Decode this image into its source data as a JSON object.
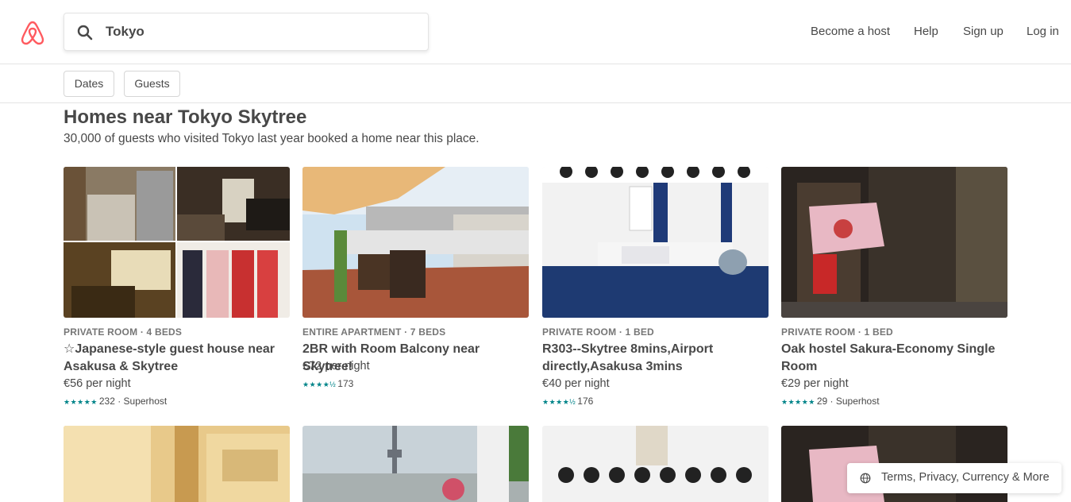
{
  "search": {
    "value": "Tokyo"
  },
  "nav": {
    "host": "Become a host",
    "help": "Help",
    "signup": "Sign up",
    "login": "Log in"
  },
  "filters": {
    "dates": "Dates",
    "guests": "Guests"
  },
  "section": {
    "title": "Homes near Tokyo Skytree",
    "subtitle": "30,000 of guests who visited Tokyo last year booked a home near this place."
  },
  "listings": [
    {
      "kicker": "PRIVATE ROOM · 4 BEDS",
      "title": "☆Japanese-style guest house near Asakusa & Skytree",
      "price": "€56 per night",
      "stars": "★★★★★",
      "rating_text": "232 · Superhost"
    },
    {
      "kicker": "ENTIRE APARTMENT · 7 BEDS",
      "title": "2BR with Room Balcony near Skytree!",
      "price": "€72 per night",
      "stars": "★★★★½",
      "rating_text": "173"
    },
    {
      "kicker": "PRIVATE ROOM · 1 BED",
      "title": "R303--Skytree 8mins,Airport directly,Asakusa 3mins",
      "price": "€40 per night",
      "stars": "★★★★½",
      "rating_text": "176"
    },
    {
      "kicker": "PRIVATE ROOM · 1 BED",
      "title": "Oak hostel Sakura-Economy Single Room",
      "price": "€29 per night",
      "stars": "★★★★★",
      "rating_text": "29 · Superhost"
    }
  ],
  "footer": {
    "label": "Terms, Privacy, Currency & More"
  },
  "colors": {
    "brand": "#FF5A5F",
    "teal": "#008489",
    "text": "#484848"
  }
}
